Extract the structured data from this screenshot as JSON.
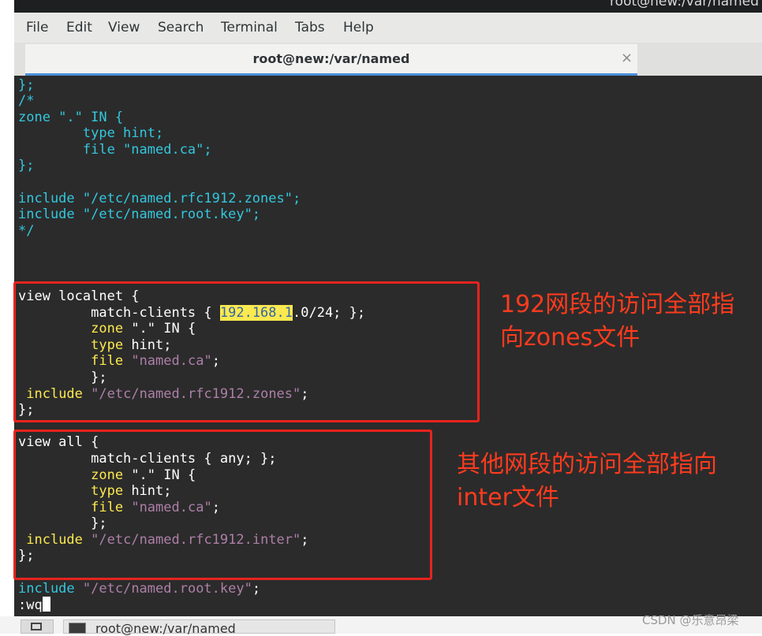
{
  "window": {
    "title": "root@new:/var/named"
  },
  "menu": {
    "items": [
      "File",
      "Edit",
      "View",
      "Search",
      "Terminal",
      "Tabs",
      "Help"
    ]
  },
  "tab": {
    "title": "root@new:/var/named",
    "close_icon": "×"
  },
  "terminal": {
    "lines": [
      [
        {
          "t": "};",
          "c": "cyan"
        }
      ],
      [
        {
          "t": "/*",
          "c": "cyan"
        }
      ],
      [
        {
          "t": "zone \".\" IN {",
          "c": "cyan"
        }
      ],
      [
        {
          "t": "        type hint;",
          "c": "cyan"
        }
      ],
      [
        {
          "t": "        file \"named.ca\";",
          "c": "cyan"
        }
      ],
      [
        {
          "t": "};",
          "c": "cyan"
        }
      ],
      [
        {
          "t": "",
          "c": "white"
        }
      ],
      [
        {
          "t": "include \"/etc/named.rfc1912.zones\";",
          "c": "cyan"
        }
      ],
      [
        {
          "t": "include \"/etc/named.root.key\";",
          "c": "cyan"
        }
      ],
      [
        {
          "t": "*/",
          "c": "cyan"
        }
      ],
      [
        {
          "t": "",
          "c": "white"
        }
      ],
      [
        {
          "t": "",
          "c": "white"
        }
      ],
      [
        {
          "t": "",
          "c": "white"
        }
      ],
      [
        {
          "t": "view localnet {",
          "c": "white"
        }
      ],
      [
        {
          "t": "         match-clients { ",
          "c": "white"
        },
        {
          "t": "192.168.1",
          "c": "hl"
        },
        {
          "t": ".0/24; };",
          "c": "white"
        }
      ],
      [
        {
          "t": "         ",
          "c": "white"
        },
        {
          "t": "zone",
          "c": "yellow"
        },
        {
          "t": " \".\" IN {",
          "c": "white"
        }
      ],
      [
        {
          "t": "         ",
          "c": "white"
        },
        {
          "t": "type",
          "c": "yellow"
        },
        {
          "t": " hint;",
          "c": "white"
        }
      ],
      [
        {
          "t": "         ",
          "c": "white"
        },
        {
          "t": "file",
          "c": "yellow"
        },
        {
          "t": " ",
          "c": "white"
        },
        {
          "t": "\"named.ca\"",
          "c": "purple"
        },
        {
          "t": ";",
          "c": "white"
        }
      ],
      [
        {
          "t": "         };",
          "c": "white"
        }
      ],
      [
        {
          "t": " ",
          "c": "white"
        },
        {
          "t": "include",
          "c": "yellow"
        },
        {
          "t": " ",
          "c": "white"
        },
        {
          "t": "\"/etc/named.rfc1912.zones\"",
          "c": "purple"
        },
        {
          "t": ";",
          "c": "white"
        }
      ],
      [
        {
          "t": "};",
          "c": "white"
        }
      ],
      [
        {
          "t": "",
          "c": "white"
        }
      ],
      [
        {
          "t": "view all {",
          "c": "white"
        }
      ],
      [
        {
          "t": "         match-clients { any; };",
          "c": "white"
        }
      ],
      [
        {
          "t": "         ",
          "c": "white"
        },
        {
          "t": "zone",
          "c": "yellow"
        },
        {
          "t": " \".\" IN {",
          "c": "white"
        }
      ],
      [
        {
          "t": "         ",
          "c": "white"
        },
        {
          "t": "type",
          "c": "yellow"
        },
        {
          "t": " hint;",
          "c": "white"
        }
      ],
      [
        {
          "t": "         ",
          "c": "white"
        },
        {
          "t": "file",
          "c": "yellow"
        },
        {
          "t": " ",
          "c": "white"
        },
        {
          "t": "\"named.ca\"",
          "c": "purple"
        },
        {
          "t": ";",
          "c": "white"
        }
      ],
      [
        {
          "t": "         };",
          "c": "white"
        }
      ],
      [
        {
          "t": " ",
          "c": "white"
        },
        {
          "t": "include",
          "c": "yellow"
        },
        {
          "t": " ",
          "c": "white"
        },
        {
          "t": "\"/etc/named.rfc1912.inter\"",
          "c": "purple"
        },
        {
          "t": ";",
          "c": "white"
        }
      ],
      [
        {
          "t": "};",
          "c": "white"
        }
      ],
      [
        {
          "t": "",
          "c": "white"
        }
      ],
      [
        {
          "t": "include",
          "c": "cyan"
        },
        {
          "t": " ",
          "c": "white"
        },
        {
          "t": "\"/etc/named.root.key\"",
          "c": "purple"
        },
        {
          "t": ";",
          "c": "white"
        }
      ],
      [
        {
          "t": ":wq",
          "c": "white"
        }
      ]
    ],
    "command_line_index": 32
  },
  "annotations": {
    "note1_line1": "192网段的访问全部指",
    "note1_line2": "向zones文件",
    "note2_line1": "其他网段的访问全部指向",
    "note2_line2": "inter文件"
  },
  "taskbar": {
    "window_label": "root@new:/var/named"
  },
  "watermark": "CSDN @乐意昂梁",
  "colors": {
    "terminal_bg": "#2b2b2b",
    "cyan": "#33c7de",
    "yellow": "#fce94f",
    "purple": "#ad7fa8",
    "annotation_red": "#e8231e"
  }
}
